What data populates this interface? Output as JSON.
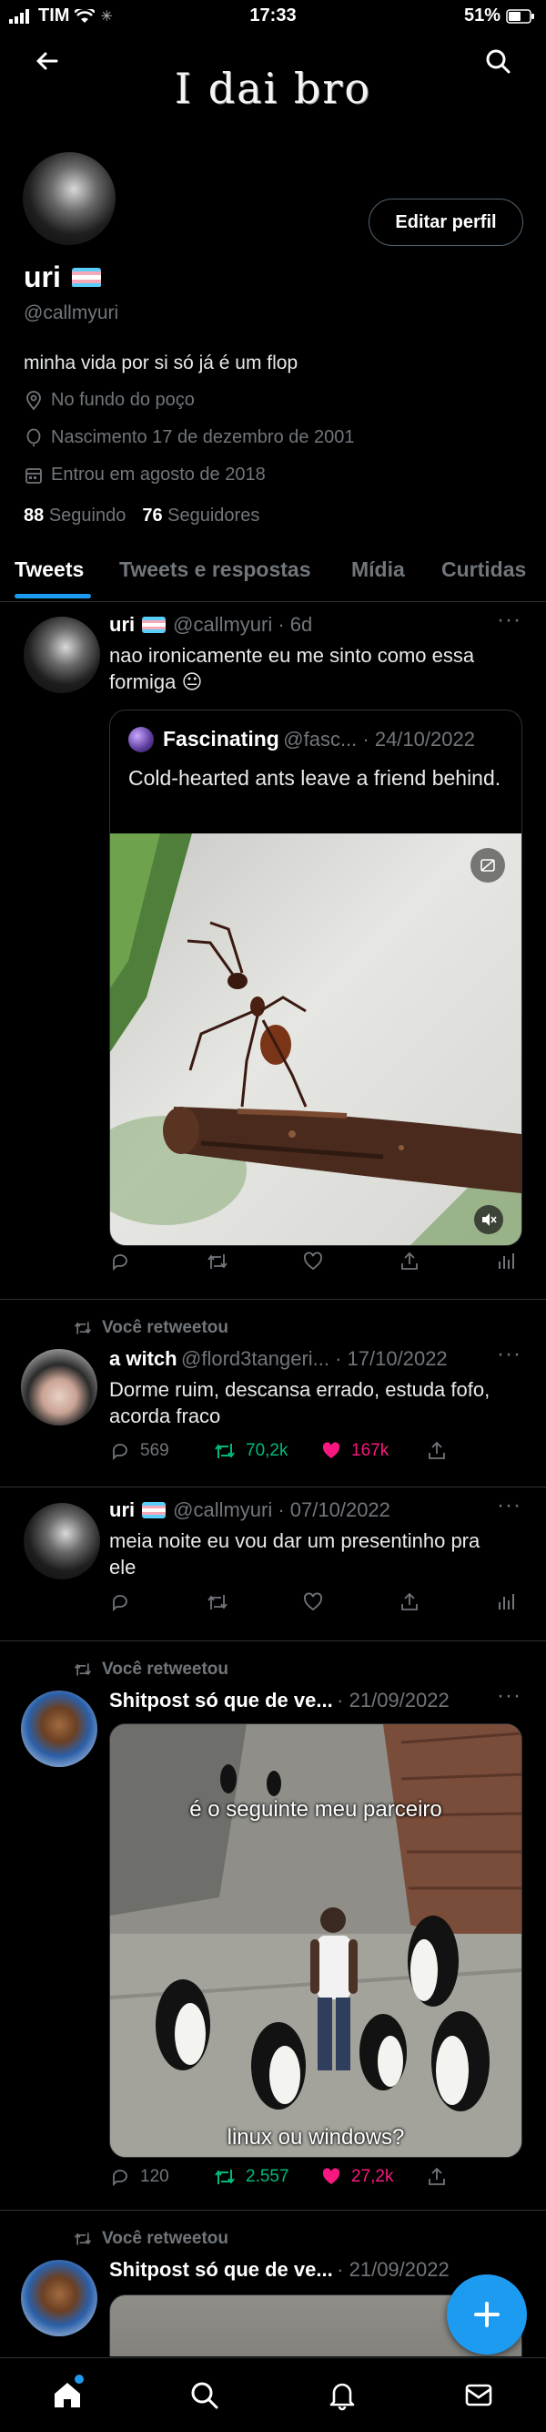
{
  "status_bar": {
    "carrier": "TIM",
    "time": "17:33",
    "battery": "51%"
  },
  "header": {
    "banner_text": "I dai bro",
    "icons": [
      "back-arrow-icon",
      "search-icon"
    ]
  },
  "profile": {
    "name": "uri",
    "handle": "@callmyuri",
    "bio": "minha vida por si só já é um flop",
    "location": "No fundo do poço",
    "birth": "Nascimento 17 de dezembro de 2001",
    "joined": "Entrou em agosto de 2018",
    "following_count": "88",
    "following_label": "Seguindo",
    "followers_count": "76",
    "followers_label": "Seguidores",
    "edit_button": "Editar perfil"
  },
  "tabs": [
    "Tweets",
    "Tweets e respostas",
    "Mídia",
    "Curtidas"
  ],
  "tweets": [
    {
      "author": "uri",
      "handle_time": "@callmyuri · 6d",
      "text": "nao ironicamente eu me sinto como essa formiga 😐",
      "quote": {
        "author": "Fascinating",
        "handle_time": "@fasc... · 24/10/2022",
        "text": "Cold-hearted ants leave a friend behind."
      }
    },
    {
      "retweet_label": "Você retweetou",
      "author": "a witch",
      "handle_time": "@flord3tangeri... · 17/10/2022",
      "text": "Dorme ruim, descansa errado, estuda fofo, acorda fraco",
      "replies": "569",
      "retweets": "70,2k",
      "likes": "167k"
    },
    {
      "author": "uri",
      "handle_time": "@callmyuri · 07/10/2022",
      "text": "meia noite eu vou dar um presentinho pra ele"
    },
    {
      "retweet_label": "Você retweetou",
      "author": "Shitpost só que de ve...",
      "handle_time": "· 21/09/2022",
      "image_top_text": "é o seguinte meu parceiro",
      "image_bottom_text": "linux ou windows?",
      "replies": "120",
      "retweets": "2.557",
      "likes": "27,2k"
    },
    {
      "retweet_label": "Você retweetou",
      "author": "Shitpost só que de ve...",
      "handle_time": "· 21/09/2022"
    }
  ],
  "colors": {
    "accent": "#1d9bf0",
    "retweet": "#00ba7c",
    "like": "#f91880",
    "muted": "#71767b"
  }
}
